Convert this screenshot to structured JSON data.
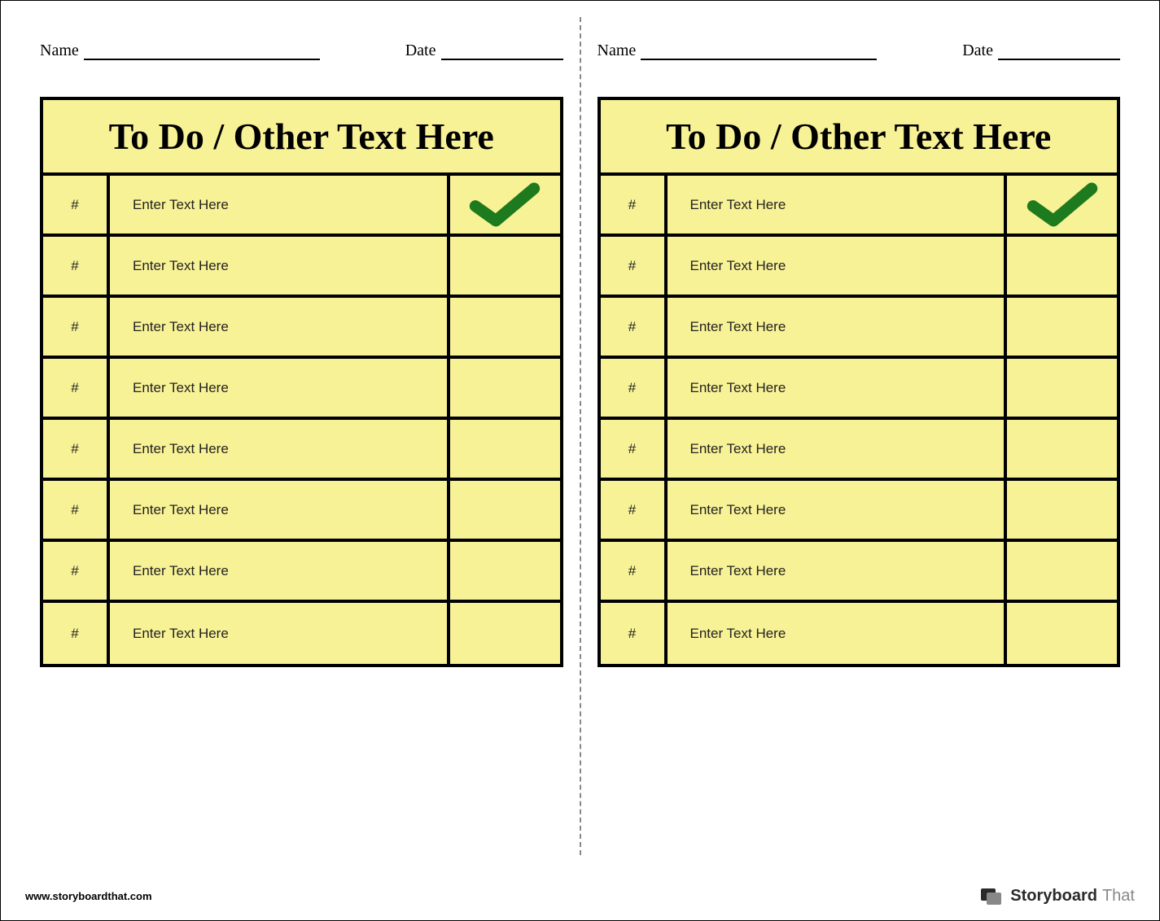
{
  "labels": {
    "name": "Name",
    "date": "Date"
  },
  "left": {
    "title": "To Do / Other Text Here",
    "rows": [
      {
        "num": "#",
        "text": "Enter Text Here",
        "checked": true
      },
      {
        "num": "#",
        "text": "Enter Text Here",
        "checked": false
      },
      {
        "num": "#",
        "text": "Enter Text Here",
        "checked": false
      },
      {
        "num": "#",
        "text": "Enter Text Here",
        "checked": false
      },
      {
        "num": "#",
        "text": "Enter Text Here",
        "checked": false
      },
      {
        "num": "#",
        "text": "Enter Text Here",
        "checked": false
      },
      {
        "num": "#",
        "text": "Enter Text Here",
        "checked": false
      },
      {
        "num": "#",
        "text": "Enter Text Here",
        "checked": false
      }
    ]
  },
  "right": {
    "title": "To Do / Other Text Here",
    "rows": [
      {
        "num": "#",
        "text": "Enter Text Here",
        "checked": true
      },
      {
        "num": "#",
        "text": "Enter Text Here",
        "checked": false
      },
      {
        "num": "#",
        "text": "Enter Text Here",
        "checked": false
      },
      {
        "num": "#",
        "text": "Enter Text Here",
        "checked": false
      },
      {
        "num": "#",
        "text": "Enter Text Here",
        "checked": false
      },
      {
        "num": "#",
        "text": "Enter Text Here",
        "checked": false
      },
      {
        "num": "#",
        "text": "Enter Text Here",
        "checked": false
      },
      {
        "num": "#",
        "text": "Enter Text Here",
        "checked": false
      }
    ]
  },
  "footer": {
    "url": "www.storyboardthat.com",
    "brand1": "Storyboard",
    "brand2": "That"
  }
}
